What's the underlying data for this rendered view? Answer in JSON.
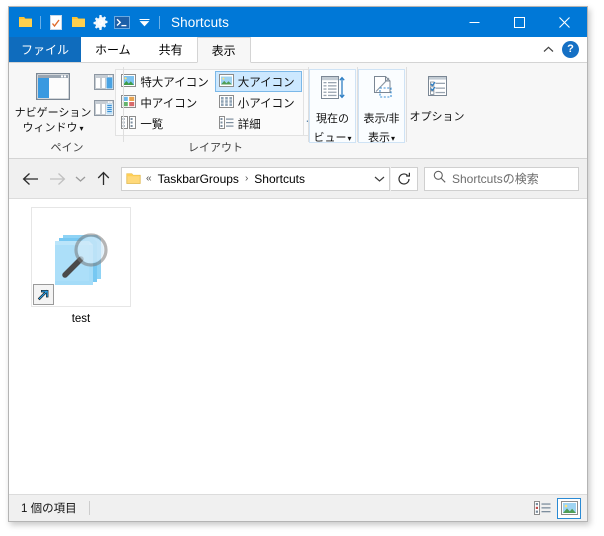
{
  "window": {
    "title": "Shortcuts",
    "quick_access": [
      {
        "name": "folder-icon",
        "glyph": "folder"
      },
      {
        "name": "properties-icon",
        "glyph": "checklist"
      },
      {
        "name": "new-folder-icon",
        "glyph": "folder"
      },
      {
        "name": "gear-icon",
        "glyph": "gear"
      },
      {
        "name": "terminal-icon",
        "glyph": "terminal"
      },
      {
        "name": "customize-chevron-icon",
        "glyph": "chevron-down"
      }
    ],
    "controls": {
      "minimize": "–",
      "maximize": "☐",
      "close": "✕"
    },
    "accent": "#0078d7"
  },
  "ribbon": {
    "tabs": [
      {
        "label": "ファイル",
        "type": "file"
      },
      {
        "label": "ホーム",
        "type": "normal"
      },
      {
        "label": "共有",
        "type": "normal"
      },
      {
        "label": "表示",
        "type": "active"
      }
    ],
    "collapse_label": "˄",
    "help_label": "?",
    "groups": [
      {
        "id": "panes",
        "label": "ペイン",
        "primary": {
          "label_line1": "ナビゲーション",
          "label_line2": "ウィンドウ",
          "caret": "▾"
        },
        "small_buttons": [
          {
            "name": "preview-pane-icon"
          },
          {
            "name": "details-pane-icon"
          }
        ]
      },
      {
        "id": "layout",
        "label": "レイアウト",
        "items": [
          {
            "label": "特大アイコン",
            "selected": false
          },
          {
            "label": "大アイコン",
            "selected": true
          },
          {
            "label": "中アイコン",
            "selected": false
          },
          {
            "label": "小アイコン",
            "selected": false
          },
          {
            "label": "一覧",
            "selected": false
          },
          {
            "label": "詳細",
            "selected": false
          }
        ],
        "scroll": [
          "▲",
          "▼",
          "▾"
        ]
      },
      {
        "id": "current-view",
        "label": "",
        "button": {
          "label_line1": "現在の",
          "label_line2": "ビュー",
          "caret": "▾"
        }
      },
      {
        "id": "show-hide",
        "label": "",
        "button": {
          "label_line1": "表示/非",
          "label_line2": "表示",
          "caret": "▾"
        }
      },
      {
        "id": "options",
        "label": "",
        "button": {
          "label_line1": "オプション",
          "label_line2": "",
          "caret": ""
        }
      }
    ]
  },
  "navigation": {
    "back": "←",
    "forward": "→",
    "recent": "˅",
    "up": "↑",
    "refresh": "↻",
    "breadcrumb": {
      "overflow": "«",
      "segments": [
        "TaskbarGroups",
        "Shortcuts"
      ],
      "separator": "›",
      "dropdown": "˅"
    },
    "search": {
      "placeholder": "Shortcutsの検索",
      "icon": "search-icon"
    }
  },
  "files": [
    {
      "name": "test",
      "icon": "search-folder-shortcut-icon",
      "is_shortcut": true
    }
  ],
  "status": {
    "item_count": "1 個の項目",
    "views": [
      {
        "name": "details-view-button",
        "active": false
      },
      {
        "name": "large-icons-view-button",
        "active": true
      }
    ]
  }
}
